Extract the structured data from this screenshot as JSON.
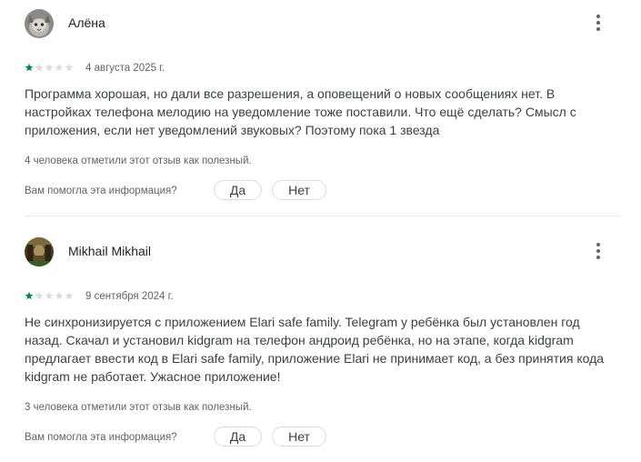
{
  "colors": {
    "star_filled": "#01875f",
    "star_empty": "#dadce0"
  },
  "reviews": [
    {
      "author": "Алёна",
      "avatar_icon": "cat-avatar",
      "rating": 1,
      "max_rating": 5,
      "date": "4 августа 2025 г.",
      "text": "Программа хорошая, но дали все разрешения, а оповещений о новых сообщениях нет. В настройках телефона мелодию на уведомление тоже поставили. Что ещё сделать? Смысл с приложения, если нет уведомлений звуковых? Поэтому пока 1 звезда",
      "helpful_count_text": "4 человека отметили этот отзыв как полезный.",
      "helpful_question": "Вам помогла эта информация?",
      "yes_label": "Да",
      "no_label": "Нет"
    },
    {
      "author": "Mikhail Mikhail",
      "avatar_icon": "photo-avatar",
      "rating": 1,
      "max_rating": 5,
      "date": "9 сентября 2024 г.",
      "text": "Не синхронизируется с приложением Elari safe family. Telegram у ребёнка был установлен год назад. Скачал и установил kidgram на телефон андроид ребёнка, но на этапе, когда kidgram предлагает ввести код в Elari safe family, приложение Elari не принимает код, а без принятия кода kidgram не работает. Ужасное приложение!",
      "helpful_count_text": "3 человека отметили этот отзыв как полезный.",
      "helpful_question": "Вам помогла эта информация?",
      "yes_label": "Да",
      "no_label": "Нет"
    }
  ]
}
